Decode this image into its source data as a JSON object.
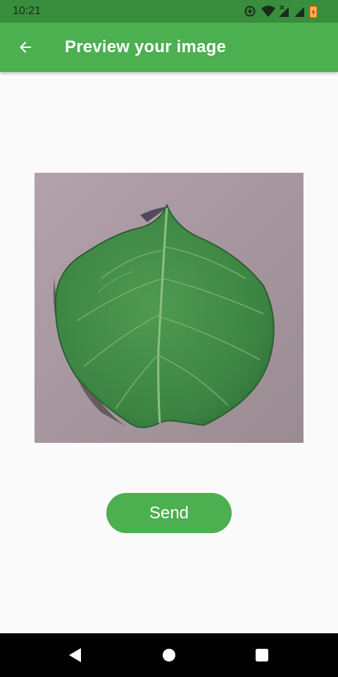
{
  "status_bar": {
    "time": "10:21",
    "icons": [
      "data-saver-icon",
      "wifi-icon",
      "signal-no-data-icon",
      "signal-icon",
      "battery-charging-icon"
    ]
  },
  "app_bar": {
    "back_icon": "arrow-back-icon",
    "title": "Preview your image"
  },
  "preview": {
    "subject": "green leaf photograph",
    "background_color": "#a7979e",
    "leaf_color": "#3f8a44"
  },
  "actions": {
    "send_label": "Send"
  },
  "colors": {
    "primary": "#4caf50",
    "primary_dark": "#388e3c",
    "background": "#fafafa"
  },
  "nav_bar": {
    "icons": [
      "back-triangle-icon",
      "home-circle-icon",
      "recents-square-icon"
    ]
  }
}
